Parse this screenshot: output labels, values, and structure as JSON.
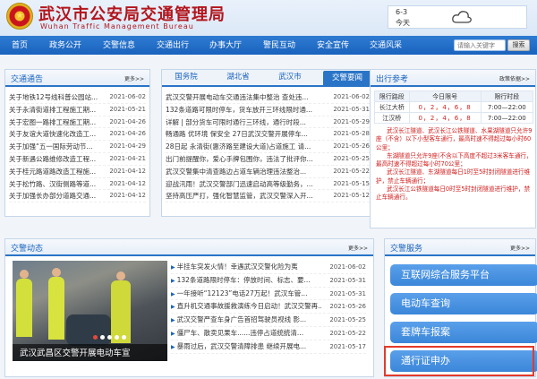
{
  "header": {
    "title": "武汉市公安局交通管理局",
    "subtitle": "Wuhan Traffic Management Bureau",
    "emblem_glyph": "★",
    "weather": {
      "date": "6-3",
      "label": "今天",
      "icon": "cloud-icon"
    }
  },
  "nav": {
    "items": [
      "首页",
      "政务公开",
      "交警信息",
      "交通出行",
      "办事大厅",
      "警民互动",
      "安全宣传",
      "交通风采"
    ],
    "search_placeholder": "请输入关键字",
    "search_button": "搜索"
  },
  "notices": {
    "title": "交通通告",
    "more": "更多>>",
    "items": [
      {
        "title": "关于地铁12号线科普公园站...",
        "date": "2021-06-02"
      },
      {
        "title": "关于永清街道排工程施工期...",
        "date": "2021-05-21"
      },
      {
        "title": "关于宏图一路排工程施工期...",
        "date": "2021-04-26"
      },
      {
        "title": "关于友谊大道快速化改造工...",
        "date": "2021-04-26"
      },
      {
        "title": "关于加强“五一国际劳动节...",
        "date": "2021-04-29"
      },
      {
        "title": "关于新遇公路维修改造工程...",
        "date": "2021-04-21"
      },
      {
        "title": "关于桂元路道路改造工程施...",
        "date": "2021-04-12"
      },
      {
        "title": "关于松竹路、汉街侧路等道...",
        "date": "2021-04-12"
      },
      {
        "title": "关于加强长办部分道路交通...",
        "date": "2021-04-12"
      }
    ]
  },
  "middle": {
    "tabs": [
      "国务院",
      "湖北省",
      "武汉市",
      "交警要闻"
    ],
    "more": "更多>>",
    "items": [
      {
        "title": "武汉交警开展电动车交通违法集中整治 查处违...",
        "date": "2021-06-02"
      },
      {
        "title": "132条道路可限时停车，货车放开三环线限时通...",
        "date": "2021-05-31"
      },
      {
        "title": "详解 | 部分货车可限时通行三环线，通行时段...",
        "date": "2021-05-29"
      },
      {
        "title": "畅通路 优环境 保安全 27日武汉交警开展停车...",
        "date": "2021-05-28"
      },
      {
        "title": "28日起 永清街(惠济路至建设大道)占道施工 请...",
        "date": "2021-05-26"
      },
      {
        "title": "出门前提醒你，爱心手牌包围你，违法了批评你...",
        "date": "2021-05-25"
      },
      {
        "title": "武汉交警集中清查路边占道车辆治理违法整治...",
        "date": "2021-05-22"
      },
      {
        "title": "迎战汛雨！武汉交警部门迅速启动高等级勤务，...",
        "date": "2021-05-15"
      },
      {
        "title": "坚持高压严打，强化智慧监管，武汉交警深入开...",
        "date": "2021-05-12"
      }
    ]
  },
  "reference": {
    "title": "出行参考",
    "more": "政策依据>>",
    "columns": [
      "限行路段",
      "今日限号",
      "限行时段"
    ],
    "rows": [
      {
        "road": "长江大桥",
        "plates": "0，2，4，6，8",
        "time": "7:00—22:00"
      },
      {
        "road": "江汉桥",
        "plates": "0，2，4，6，8",
        "time": "7:00—22:00"
      }
    ],
    "notes": [
      "武汉长江隧道、武汉长江公铁隧道、水果湖隧道只允许9座（不含）以下小型客车通行，最高时速不得超过每小时60公里；",
      "东湖隧道只允许9座(不含以下高度不超过3米客车通行，最高时速不得超过每小时70公里；",
      "武汉长江隧道、东湖隧道每日1时至5时封闭隧道进行维护，禁止车辆通行；",
      "武汉长江公铁隧道每日0时至5时封闭隧道进行维护，禁止车辆通行。"
    ]
  },
  "police": {
    "title": "交警动态",
    "more": "更多>>",
    "photo_caption": "武汉武昌区交警开展电动车宣",
    "items": [
      {
        "title": "半挂车突发火情！幸遇武汉交警化险为夷",
        "date": "2021-06-02"
      },
      {
        "title": "132条道路限时停车：停放时间、标志、要...",
        "date": "2021-05-31"
      },
      {
        "title": "一年接听“12123”电话27万起！武汉车管...",
        "date": "2021-05-31"
      },
      {
        "title": "直升机交通事故援救演练今日启动！武汉交警再...",
        "date": "2021-05-26"
      },
      {
        "title": "武汉交警严查车身广告首招驾驶员视线 影...",
        "date": "2021-05-25"
      },
      {
        "title": "僵尸车、散卖见果车......违停占道统统清...",
        "date": "2021-05-22"
      },
      {
        "title": "暴雨过后，武汉交警清障排患 继续开展电...",
        "date": "2021-05-17"
      }
    ]
  },
  "services": {
    "title": "交警服务",
    "more": "更多>>",
    "buttons": [
      "互联网综合服务平台",
      "电动车查询",
      "套牌车报案",
      "通行证申办"
    ]
  },
  "colors": {
    "brand": "#b3151c",
    "nav": "#1a63be",
    "accent_red": "#d21c1c",
    "highlight": "#e23b2b"
  }
}
